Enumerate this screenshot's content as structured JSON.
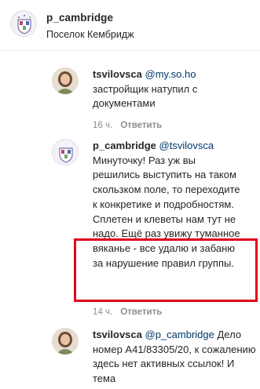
{
  "header": {
    "name": "p_cambridge",
    "subtitle": "Поселок Кембридж"
  },
  "comments": [
    {
      "user": "tsvilovsca",
      "mention": "@my.so.ho",
      "text": "застройщик натупил с документами",
      "time": "16 ч.",
      "reply_label": "Ответить"
    },
    {
      "user": "p_cambridge",
      "mention": "@tsvilovsca",
      "text": "Минуточку! Раз уж вы решились выступить на таком скользком поле, то переходите к конкретике и подробностям. Сплетен и клеветы нам тут не надо. Ещё раз увижу туманное вяканье - все удалю и забаню за нарушение правил группы.",
      "time": "14 ч.",
      "reply_label": "Ответить"
    },
    {
      "user": "tsvilovsca",
      "mention": "@p_cambridge",
      "text": "Дело номер А41/83305/20, к сожалению здесь нет активных ссылок! И тема"
    }
  ],
  "colors": {
    "username": "#262626",
    "mention": "#00376b",
    "meta": "#8e8e8e",
    "highlight": "#e3001b"
  }
}
